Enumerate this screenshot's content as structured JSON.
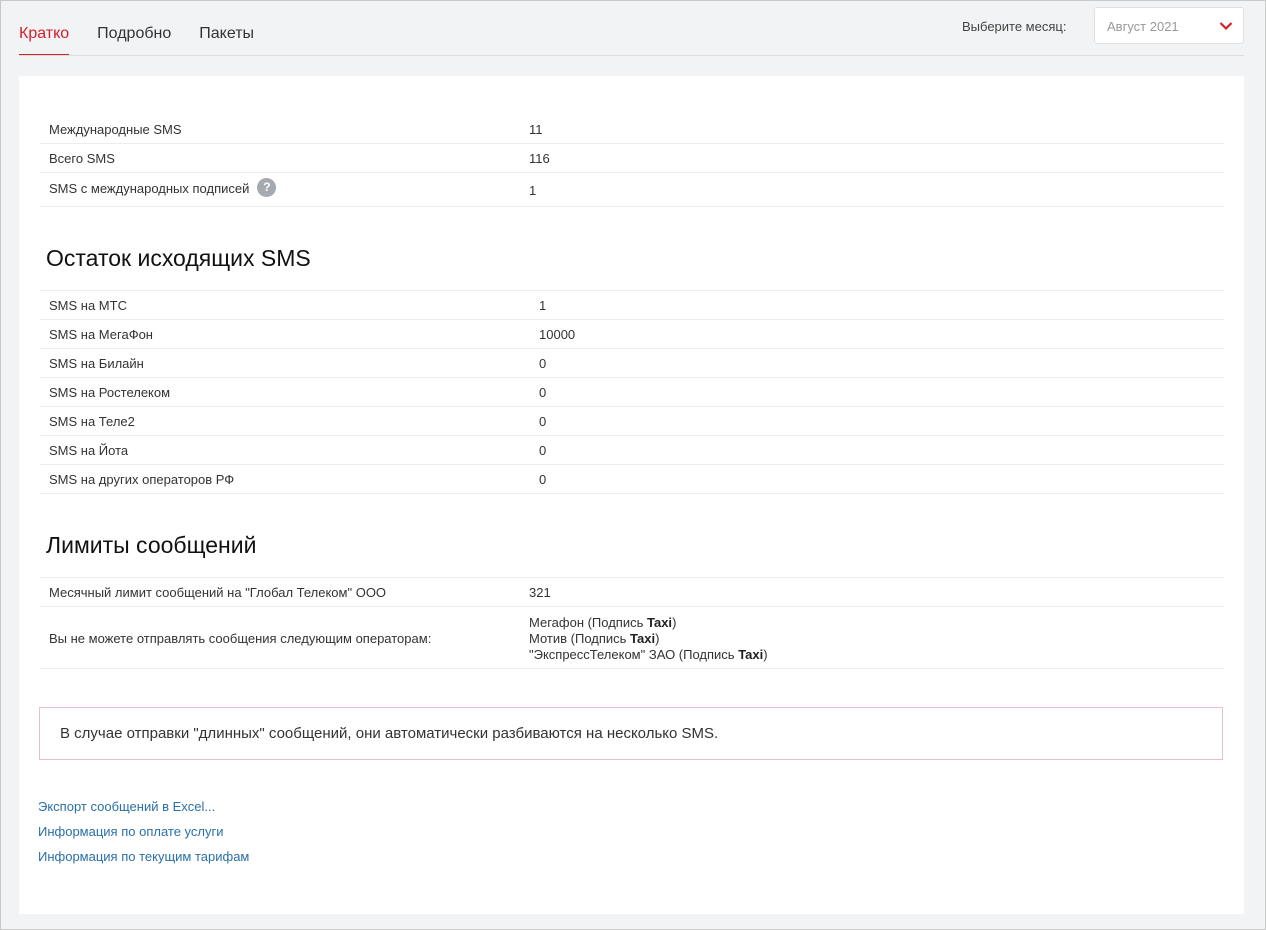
{
  "tabs": [
    "Кратко",
    "Подробно",
    "Пакеты"
  ],
  "month": {
    "label": "Выберите месяц:",
    "value": "Август 2021"
  },
  "summary": [
    {
      "label": "Международные SMS",
      "value": "11"
    },
    {
      "label": "Всего SMS",
      "value": "116"
    },
    {
      "label": "SMS с международных подписей",
      "value": "1",
      "help": "?"
    }
  ],
  "remaining": {
    "title": "Остаток исходящих SMS",
    "rows": [
      {
        "label": "SMS на МТС",
        "value": "1"
      },
      {
        "label": "SMS на МегаФон",
        "value": "10000"
      },
      {
        "label": "SMS на Билайн",
        "value": "0"
      },
      {
        "label": "SMS на Ростелеком",
        "value": "0"
      },
      {
        "label": "SMS на Теле2",
        "value": "0"
      },
      {
        "label": "SMS на Йота",
        "value": "0"
      },
      {
        "label": "SMS на других операторов РФ",
        "value": "0"
      }
    ]
  },
  "limits": {
    "title": "Лимиты сообщений",
    "monthly_label": "Месячный лимит сообщений на \"Глобал Телеком\" ООО",
    "monthly_value": "321",
    "blocked_label": "Вы не можете отправлять сообщения следующим операторам:",
    "blocked_ops": [
      {
        "before": "Мегафон (Подпись ",
        "sig": "Taxi",
        "after": ")"
      },
      {
        "before": "Мотив (Подпись ",
        "sig": "Taxi",
        "after": ")"
      },
      {
        "before": "\"ЭкспрессТелеком\" ЗАО (Подпись ",
        "sig": "Taxi",
        "after": ")"
      }
    ]
  },
  "notice": "В случае отправки \"длинных\" сообщений, они автоматически разбиваются на несколько SMS.",
  "links": [
    "Экспорт сообщений в Excel...",
    "Информация по оплате услуги",
    "Информация по текущим тарифам"
  ],
  "colors": {
    "accent": "#d31f29",
    "link": "#2a6fa8",
    "notice_border": "#e9c0c6"
  },
  "icons": {
    "month_chevron": "chevron-down-icon",
    "help": "help-icon"
  }
}
